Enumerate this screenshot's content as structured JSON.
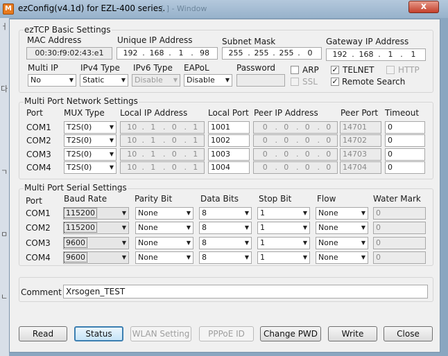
{
  "window": {
    "title": "ezConfig(v4.1d) for EZL-400 series.",
    "ghost_text": "[ ] - Window",
    "app_icon": "M",
    "close_label": "x"
  },
  "basic": {
    "legend": "ezTCP Basic Settings",
    "mac_label": "MAC Address",
    "mac_value": "00:30:f9:02:43:e1",
    "ip_label": "Unique IP Address",
    "ip": [
      "192",
      "168",
      "1",
      "98"
    ],
    "mask_label": "Subnet Mask",
    "mask": [
      "255",
      "255",
      "255",
      "0"
    ],
    "gw_label": "Gateway IP Address",
    "gw": [
      "192",
      "168",
      "1",
      "1"
    ],
    "multiip_label": "Multi IP",
    "multiip_value": "No",
    "ipv4_label": "IPv4 Type",
    "ipv4_value": "Static",
    "ipv6_label": "IPv6 Type",
    "ipv6_value": "Disable",
    "eapol_label": "EAPoL",
    "eapol_value": "Disable",
    "password_label": "Password",
    "password_value": "",
    "arp_label": "ARP",
    "arp_checked": false,
    "ssl_label": "SSL",
    "ssl_checked": false,
    "telnet_label": "TELNET",
    "telnet_checked": true,
    "http_label": "HTTP",
    "http_checked": false,
    "remote_label": "Remote Search",
    "remote_checked": true
  },
  "network": {
    "legend": "Multi Port Network Settings",
    "headers": {
      "port": "Port",
      "mux": "MUX Type",
      "local_ip": "Local IP Address",
      "local_port": "Local Port",
      "peer_ip": "Peer IP Address",
      "peer_port": "Peer Port",
      "timeout": "Timeout"
    },
    "rows": [
      {
        "port": "COM1",
        "mux": "T2S(0)",
        "local_ip": [
          "10",
          "1",
          "0",
          "1"
        ],
        "local_port": "1001",
        "peer_ip": [
          "0",
          "0",
          "0",
          "0"
        ],
        "peer_port": "14701",
        "timeout": "0"
      },
      {
        "port": "COM2",
        "mux": "T2S(0)",
        "local_ip": [
          "10",
          "1",
          "0",
          "1"
        ],
        "local_port": "1002",
        "peer_ip": [
          "0",
          "0",
          "0",
          "0"
        ],
        "peer_port": "14702",
        "timeout": "0"
      },
      {
        "port": "COM3",
        "mux": "T2S(0)",
        "local_ip": [
          "10",
          "1",
          "0",
          "1"
        ],
        "local_port": "1003",
        "peer_ip": [
          "0",
          "0",
          "0",
          "0"
        ],
        "peer_port": "14703",
        "timeout": "0"
      },
      {
        "port": "COM4",
        "mux": "T2S(0)",
        "local_ip": [
          "10",
          "1",
          "0",
          "1"
        ],
        "local_port": "1004",
        "peer_ip": [
          "0",
          "0",
          "0",
          "0"
        ],
        "peer_port": "14704",
        "timeout": "0"
      }
    ]
  },
  "serial": {
    "legend": "Multi Port Serial Settings",
    "headers": {
      "port": "Port",
      "baud": "Baud Rate",
      "parity": "Parity Bit",
      "data": "Data Bits",
      "stop": "Stop Bit",
      "flow": "Flow",
      "water": "Water Mark"
    },
    "rows": [
      {
        "port": "COM1",
        "baud": "115200",
        "parity": "None",
        "data": "8",
        "stop": "1",
        "flow": "None",
        "water": "0"
      },
      {
        "port": "COM2",
        "baud": "115200",
        "parity": "None",
        "data": "8",
        "stop": "1",
        "flow": "None",
        "water": "0"
      },
      {
        "port": "COM3",
        "baud": "9600",
        "parity": "None",
        "data": "8",
        "stop": "1",
        "flow": "None",
        "water": "0"
      },
      {
        "port": "COM4",
        "baud": "9600",
        "parity": "None",
        "data": "8",
        "stop": "1",
        "flow": "None",
        "water": "0"
      }
    ]
  },
  "comment": {
    "label": "Comment",
    "value": "Xrsogen_TEST"
  },
  "buttons": {
    "read": "Read",
    "status": "Status",
    "wlan": "WLAN Setting",
    "pppoe": "PPPoE ID",
    "change_pwd": "Change PWD",
    "write": "Write",
    "close": "Close"
  },
  "icons": {
    "check_glyph": "✓",
    "arrow_glyph": "▼"
  },
  "colors": {
    "titlebar": "#97b2cb",
    "client": "#f0f0f0",
    "close": "#c4402c",
    "focus_border": "#3c7fb1"
  }
}
